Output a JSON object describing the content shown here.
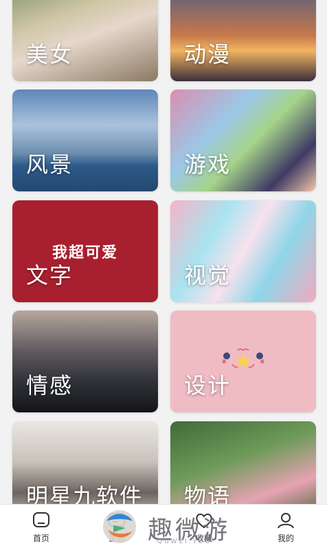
{
  "categories": [
    {
      "label": "美女"
    },
    {
      "label": "动漫"
    },
    {
      "label": "风景"
    },
    {
      "label": "游戏"
    },
    {
      "label": "文字",
      "overlay_text": "我超可爱"
    },
    {
      "label": "视觉"
    },
    {
      "label": "情感"
    },
    {
      "label": "设计"
    },
    {
      "label": "明星九软件"
    },
    {
      "label": "物语"
    }
  ],
  "tabbar": {
    "home": "首页",
    "select": "筐选",
    "favorite": "收藏",
    "me": "我的"
  },
  "watermark": {
    "brand": "趣微游",
    "sub": "QUWEI.YOU"
  }
}
